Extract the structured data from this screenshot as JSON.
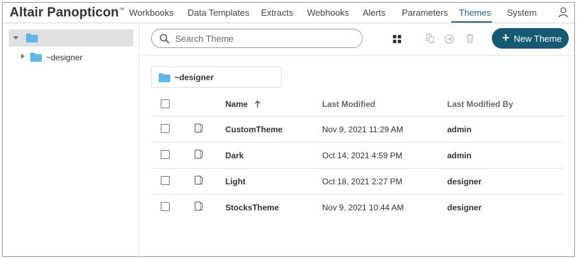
{
  "app": {
    "brand": "Altair Panopticon",
    "trademark": "™"
  },
  "nav": {
    "items": [
      {
        "label": "Workbooks"
      },
      {
        "label": "Data Templates"
      },
      {
        "label": "Extracts"
      },
      {
        "label": "Webhooks"
      },
      {
        "label": "Alerts"
      },
      {
        "label": "Parameters"
      },
      {
        "label": "Themes",
        "active": true
      },
      {
        "label": "System"
      }
    ]
  },
  "tree": {
    "root": {
      "label": ""
    },
    "children": [
      {
        "label": "~designer"
      }
    ]
  },
  "search": {
    "placeholder": "Search Theme",
    "value": ""
  },
  "toolbar": {
    "new_label": "New Theme"
  },
  "breadcrumb": {
    "label": "~designer"
  },
  "table": {
    "headers": {
      "name": "Name",
      "modified": "Last Modified",
      "modified_by": "Last Modified By"
    },
    "sort": {
      "column": "Name",
      "direction": "ascending"
    },
    "rows": [
      {
        "name": "CustomTheme",
        "modified": "Nov 9, 2021 11:29 AM",
        "modified_by": "admin"
      },
      {
        "name": "Dark",
        "modified": "Oct 14, 2021 4:59 PM",
        "modified_by": "admin"
      },
      {
        "name": "Light",
        "modified": "Oct 18, 2021 2:27 PM",
        "modified_by": "designer"
      },
      {
        "name": "StocksTheme",
        "modified": "Nov 9, 2021 10:44 AM",
        "modified_by": "designer"
      }
    ]
  },
  "colors": {
    "accent": "#155a74",
    "active_tab": "#1a6b87",
    "folder": "#5cb8e6"
  },
  "icons": [
    "user-icon",
    "search-icon",
    "grid-view-icon",
    "copy-icon",
    "move-icon",
    "delete-icon",
    "folder-icon",
    "theme-icon",
    "sort-ascending-icon"
  ]
}
